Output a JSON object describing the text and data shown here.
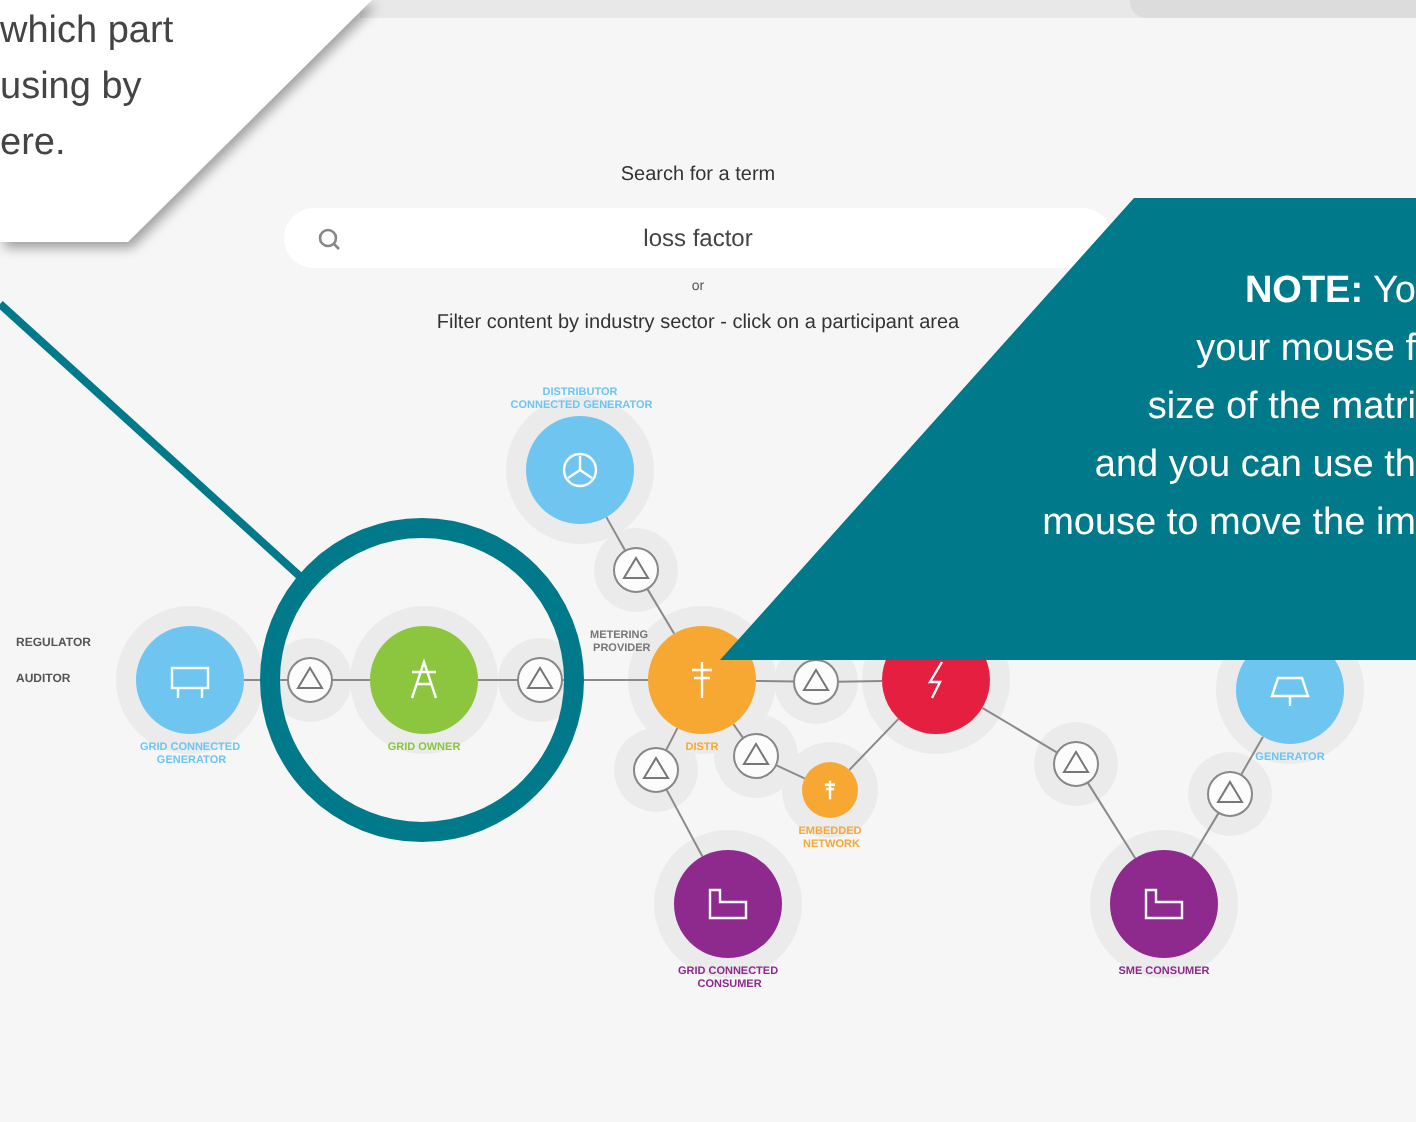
{
  "callout_left": {
    "lines": [
      "which part",
      "using by",
      "ere."
    ]
  },
  "search": {
    "heading": "Search for a term",
    "value": "loss factor",
    "separator": "or",
    "filter_hint": "Filter content by industry sector - click on a participant area"
  },
  "side_labels": [
    "REGULATOR",
    "AUDITOR"
  ],
  "nodes": [
    {
      "kind": "participant",
      "label": "DISTRIBUTOR CONNECTED GENERATOR",
      "color": "#6ec6f0"
    },
    {
      "kind": "meter"
    },
    {
      "kind": "participant",
      "label": "GRID CONNECTED GENERATOR",
      "color": "#6ec6f0"
    },
    {
      "kind": "meter"
    },
    {
      "kind": "participant",
      "label": "GRID OWNER",
      "color": "#8cc63f"
    },
    {
      "kind": "meter",
      "label": "METERING PROVIDER"
    },
    {
      "kind": "participant",
      "label": "DISTR",
      "color": "#f7a833"
    },
    {
      "kind": "meter"
    },
    {
      "kind": "participant",
      "color": "#e51f3f"
    },
    {
      "kind": "participant",
      "label": "GENERATOR",
      "color": "#6ec6f0"
    },
    {
      "kind": "meter"
    },
    {
      "kind": "meter"
    },
    {
      "kind": "meter"
    },
    {
      "kind": "participant",
      "label": "EMBEDDED NETWORK",
      "color": "#f7a833"
    },
    {
      "kind": "meter"
    },
    {
      "kind": "participant",
      "label": "GRID CONNECTED CONSUMER",
      "color": "#8e2a8e"
    },
    {
      "kind": "participant",
      "label": "SME CONSUMER",
      "color": "#8e2a8e"
    }
  ],
  "note": {
    "lines": [
      "**NOTE:** Yo",
      "your mouse f",
      "size of the matri",
      "and you can use th",
      "mouse to move the im"
    ]
  }
}
